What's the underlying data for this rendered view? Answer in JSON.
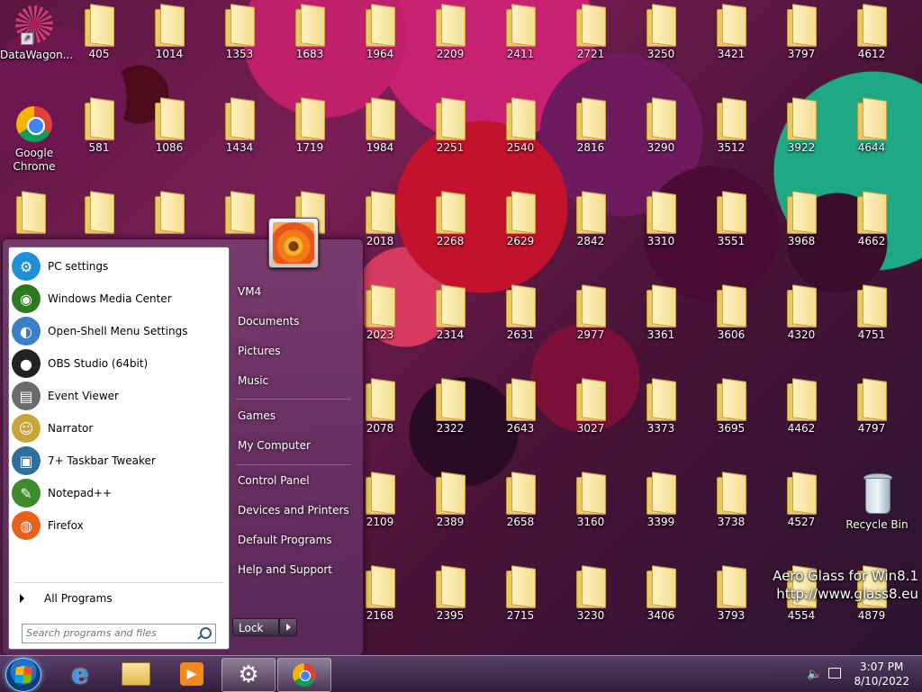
{
  "desktop": {
    "shortcuts": {
      "datawagon": "DataWagon...",
      "chrome": "Google Chrome"
    },
    "folders_row1": [
      "405",
      "1014",
      "1353",
      "1683",
      "1964",
      "2209",
      "2411",
      "2721",
      "3250",
      "3421",
      "3797",
      "4612"
    ],
    "folders_row2": [
      "581",
      "1086",
      "1434",
      "1719",
      "1984",
      "2251",
      "2540",
      "2816",
      "3290",
      "3512",
      "3922",
      "4644"
    ],
    "folders_row3": [
      "2018",
      "2268",
      "2629",
      "2842",
      "3310",
      "3551",
      "3968",
      "4662"
    ],
    "folders_row4": [
      "2023",
      "2314",
      "2631",
      "2977",
      "3361",
      "3606",
      "4320",
      "4751"
    ],
    "folders_row5": [
      "2078",
      "2322",
      "2643",
      "3027",
      "3373",
      "3695",
      "4462",
      "4797"
    ],
    "folders_row6": [
      "2109",
      "2389",
      "2658",
      "3160",
      "3399",
      "3738",
      "4527"
    ],
    "folders_row7": [
      "2168",
      "2395",
      "2715",
      "3230",
      "3406",
      "3793",
      "4554",
      "4879"
    ],
    "recycle_bin": "Recycle Bin"
  },
  "start_menu": {
    "programs": [
      {
        "label": "PC settings",
        "icon": "gear-icon"
      },
      {
        "label": "Windows Media Center",
        "icon": "windows-media-center-icon"
      },
      {
        "label": "Open-Shell Menu Settings",
        "icon": "open-shell-icon"
      },
      {
        "label": "OBS Studio (64bit)",
        "icon": "obs-icon"
      },
      {
        "label": "Event Viewer",
        "icon": "event-viewer-icon"
      },
      {
        "label": "Narrator",
        "icon": "narrator-icon"
      },
      {
        "label": "7+ Taskbar Tweaker",
        "icon": "taskbar-tweaker-icon"
      },
      {
        "label": "Notepad++",
        "icon": "notepadpp-icon"
      },
      {
        "label": "Firefox",
        "icon": "firefox-icon"
      }
    ],
    "all_programs": "All Programs",
    "search_placeholder": "Search programs and files",
    "right_links": {
      "user": "VM4",
      "documents": "Documents",
      "pictures": "Pictures",
      "music": "Music",
      "games": "Games",
      "computer": "My Computer",
      "control_panel": "Control Panel",
      "devices": "Devices and Printers",
      "defaults": "Default Programs",
      "help": "Help and Support"
    },
    "lock_label": "Lock"
  },
  "taskbar": {
    "pinned": [
      "internet-explorer-icon",
      "file-explorer-icon",
      "media-player-icon",
      "settings-icon",
      "chrome-icon"
    ],
    "time": "3:07 PM",
    "date": "8/10/2022"
  },
  "watermark": {
    "line1": "Aero Glass for Win8.1",
    "line2": "http://www.glass8.eu"
  },
  "colors": {
    "folder": "#f3dc8e",
    "start_panel": "#7a3c6e",
    "taskbar": "#3c2648"
  }
}
